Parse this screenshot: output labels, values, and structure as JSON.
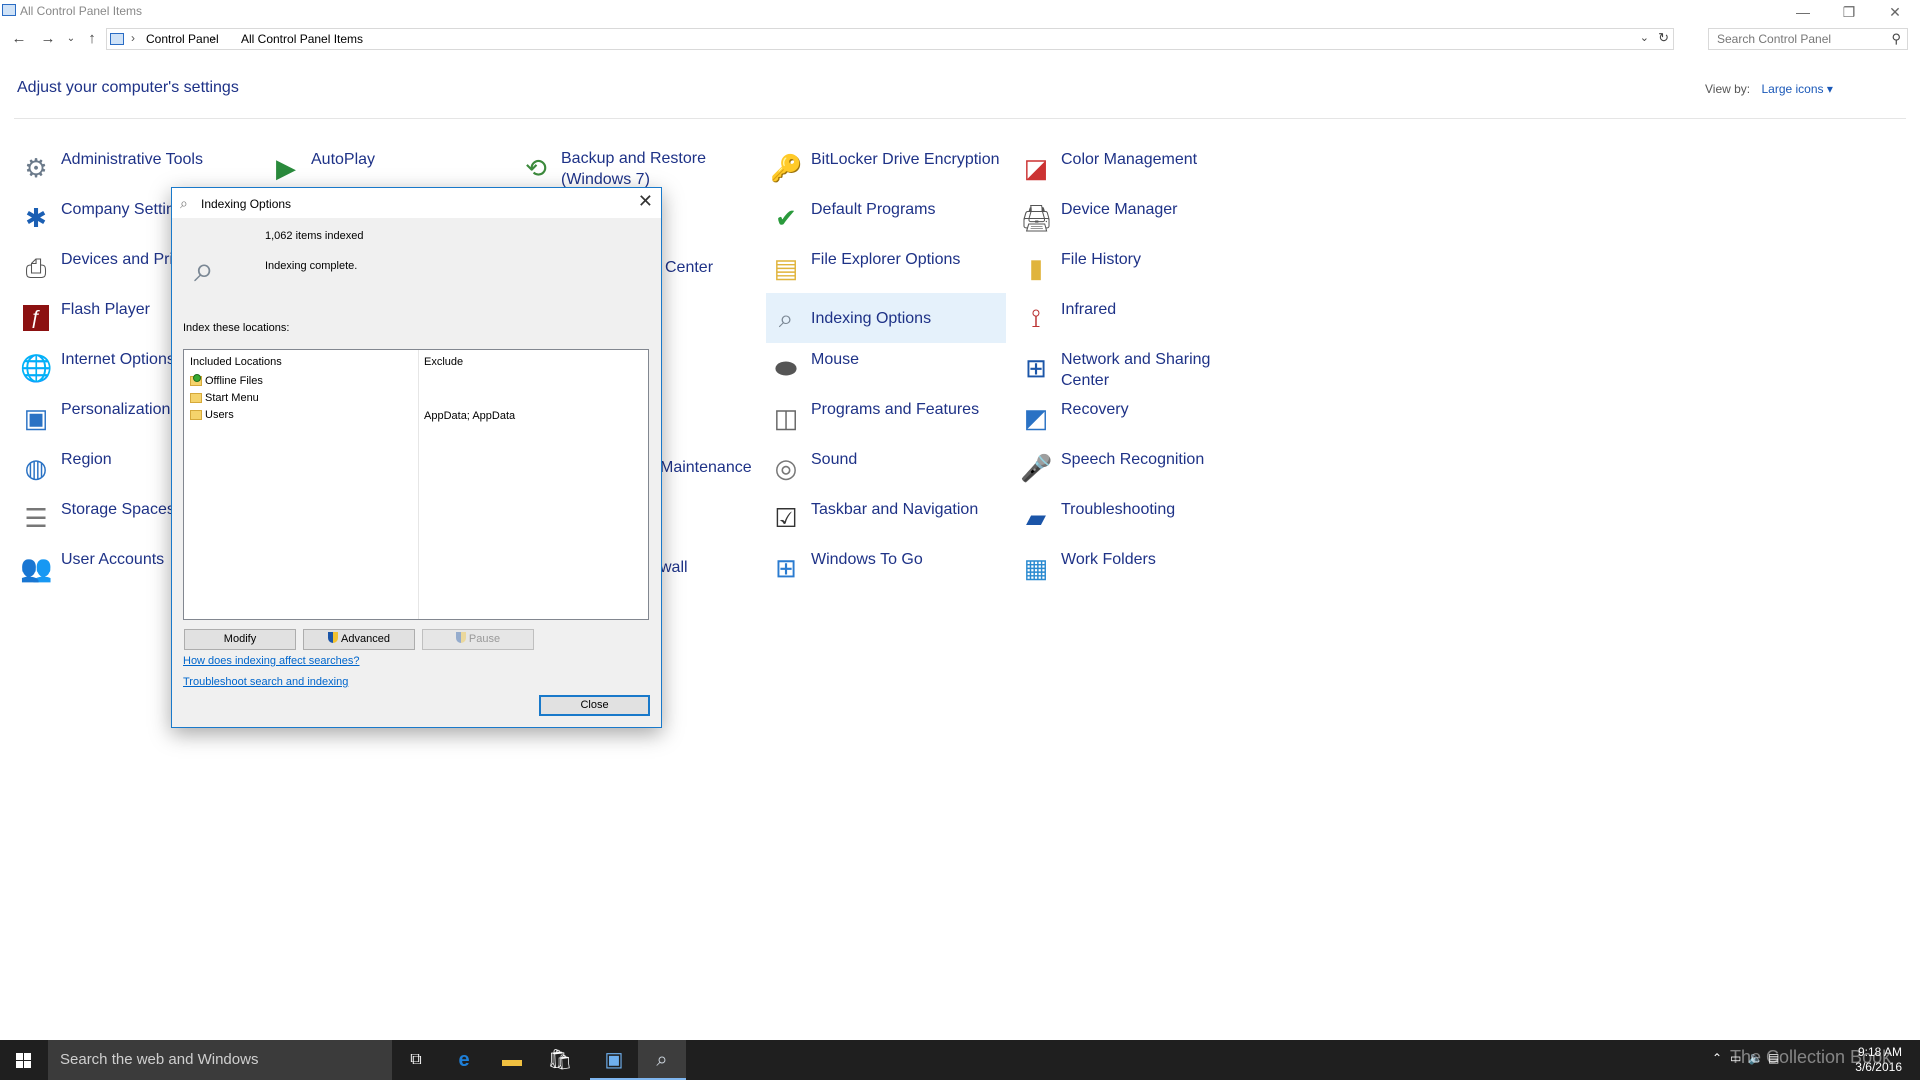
{
  "window": {
    "title": "All Control Panel Items",
    "controls": {
      "minimize": "—",
      "restore": "❐",
      "close": "✕"
    }
  },
  "address": {
    "crumbs": [
      "Control Panel",
      "All Control Panel Items"
    ],
    "search_placeholder": "Search Control Panel"
  },
  "main": {
    "heading": "Adjust your computer's settings",
    "view_by_label": "View by:",
    "view_by_value": "Large icons ▾"
  },
  "items": {
    "col1": [
      "Administrative Tools",
      "Company Settings",
      "Devices and Printers",
      "Flash Player",
      "Internet Options",
      "Personalization",
      "Region",
      "Storage Spaces",
      "User Accounts"
    ],
    "col2": [
      "AutoPlay"
    ],
    "col3_visible": [
      "Backup and Restore (Windows 7)",
      "Center",
      "Maintenance",
      "wall"
    ],
    "col4": [
      "BitLocker Drive Encryption",
      "Default Programs",
      "File Explorer Options",
      "Indexing Options",
      "Mouse",
      "Programs and Features",
      "Sound",
      "Taskbar and Navigation",
      "Windows To Go"
    ],
    "col5": [
      "Color Management",
      "Device Manager",
      "File History",
      "Infrared",
      "Network and Sharing Center",
      "Recovery",
      "Speech Recognition",
      "Troubleshooting",
      "Work Folders"
    ]
  },
  "dialog": {
    "title": "Indexing Options",
    "items_indexed": "1,062 items indexed",
    "status": "Indexing complete.",
    "index_label": "Index these locations:",
    "col_included": "Included Locations",
    "col_exclude": "Exclude",
    "locations": [
      {
        "name": "Offline Files",
        "exclude": ""
      },
      {
        "name": "Start Menu",
        "exclude": ""
      },
      {
        "name": "Users",
        "exclude": "AppData; AppData"
      }
    ],
    "buttons": {
      "modify": "Modify",
      "advanced": "Advanced",
      "pause": "Pause",
      "close": "Close"
    },
    "links": {
      "affect": "How does indexing affect searches?",
      "troubleshoot": "Troubleshoot search and indexing"
    }
  },
  "taskbar": {
    "search_placeholder": "Search the web and Windows",
    "time": "9:18 AM",
    "date": "3/6/2016",
    "watermark": "The Collection Book"
  },
  "colors": {
    "link": "#1e3287",
    "accent": "#1979ca",
    "taskbar": "#1f1f1f"
  }
}
